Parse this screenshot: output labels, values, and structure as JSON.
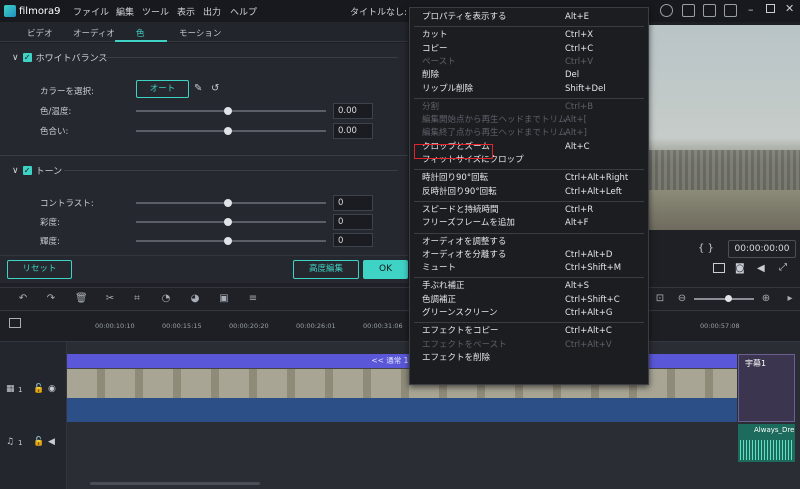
{
  "app": {
    "name": "filmora9",
    "doc_title": "タイトルなし: 00:00:00:00"
  },
  "menubar": [
    "ファイル",
    "編集",
    "ツール",
    "表示",
    "出力",
    "ヘルプ"
  ],
  "tabs": [
    "ビデオ",
    "オーディオ",
    "色",
    "モーション"
  ],
  "active_tab": "色",
  "white_balance": {
    "title": "ホワイトバランス",
    "color_select_label": "カラーを選択:",
    "auto_label": "オート",
    "temp_label": "色/温度:",
    "temp_value": "0.00",
    "tint_label": "色合い:",
    "tint_value": "0.00"
  },
  "tone": {
    "title": "トーン",
    "contrast_label": "コントラスト:",
    "contrast_value": "0",
    "saturation_label": "彩度:",
    "saturation_value": "0",
    "brightness_label": "輝度:",
    "brightness_value": "0"
  },
  "buttons": {
    "reset": "リセット",
    "advanced": "高度編集",
    "ok": "OK"
  },
  "player": {
    "timecode": "00:00:00:00",
    "brackets": "{ }"
  },
  "ruler": [
    "00:00:10:10",
    "00:00:15:15",
    "00:00:20:20",
    "00:00:26:01",
    "00:00:31:06",
    "00:00:57:08"
  ],
  "timeline": {
    "speed_label": "<< 通常 1.00x ∨",
    "title_clip": "宇幕1",
    "audio_clip": "Always_Dre",
    "video_track": "1",
    "audio_track": "1"
  },
  "context_menu": [
    {
      "label": "プロパティを表示する",
      "shortcut": "Alt+E",
      "enabled": true
    },
    {
      "sep": true
    },
    {
      "label": "カット",
      "shortcut": "Ctrl+X",
      "enabled": true
    },
    {
      "label": "コピー",
      "shortcut": "Ctrl+C",
      "enabled": true
    },
    {
      "label": "ペースト",
      "shortcut": "Ctrl+V",
      "enabled": false
    },
    {
      "label": "削除",
      "shortcut": "Del",
      "enabled": true
    },
    {
      "label": "リップル削除",
      "shortcut": "Shift+Del",
      "enabled": true
    },
    {
      "sep": true
    },
    {
      "label": "分割",
      "shortcut": "Ctrl+B",
      "enabled": false
    },
    {
      "label": "編集開始点から再生ヘッドまでトリム",
      "shortcut": "Alt+[",
      "enabled": false
    },
    {
      "label": "編集終了点から再生ヘッドまでトリム",
      "shortcut": "Alt+]",
      "enabled": false
    },
    {
      "label": "クロップとズーム",
      "shortcut": "Alt+C",
      "enabled": true
    },
    {
      "label": "フィットサイズにクロップ",
      "shortcut": "",
      "enabled": true
    },
    {
      "sep": true
    },
    {
      "label": "時計回り90°回転",
      "shortcut": "Ctrl+Alt+Right",
      "enabled": true
    },
    {
      "label": "反時計回り90°回転",
      "shortcut": "Ctrl+Alt+Left",
      "enabled": true
    },
    {
      "sep": true
    },
    {
      "label": "スピードと持続時間",
      "shortcut": "Ctrl+R",
      "enabled": true
    },
    {
      "label": "フリーズフレームを追加",
      "shortcut": "Alt+F",
      "enabled": true
    },
    {
      "sep": true
    },
    {
      "label": "オーディオを調整する",
      "shortcut": "",
      "enabled": true
    },
    {
      "label": "オーディオを分離する",
      "shortcut": "Ctrl+Alt+D",
      "enabled": true
    },
    {
      "label": "ミュート",
      "shortcut": "Ctrl+Shift+M",
      "enabled": true
    },
    {
      "sep": true
    },
    {
      "label": "手ぶれ補正",
      "shortcut": "Alt+S",
      "enabled": true
    },
    {
      "label": "色調補正",
      "shortcut": "Ctrl+Shift+C",
      "enabled": true
    },
    {
      "label": "グリーンスクリーン",
      "shortcut": "Ctrl+Alt+G",
      "enabled": true
    },
    {
      "sep": true
    },
    {
      "label": "エフェクトをコピー",
      "shortcut": "Ctrl+Alt+C",
      "enabled": true
    },
    {
      "label": "エフェクトをペースト",
      "shortcut": "Ctrl+Alt+V",
      "enabled": false
    },
    {
      "label": "エフェクトを削除",
      "shortcut": "",
      "enabled": true
    }
  ],
  "colors": {
    "accent": "#3fd3c6",
    "highlight": "#e0262b",
    "speedbar": "#5a58d8"
  }
}
